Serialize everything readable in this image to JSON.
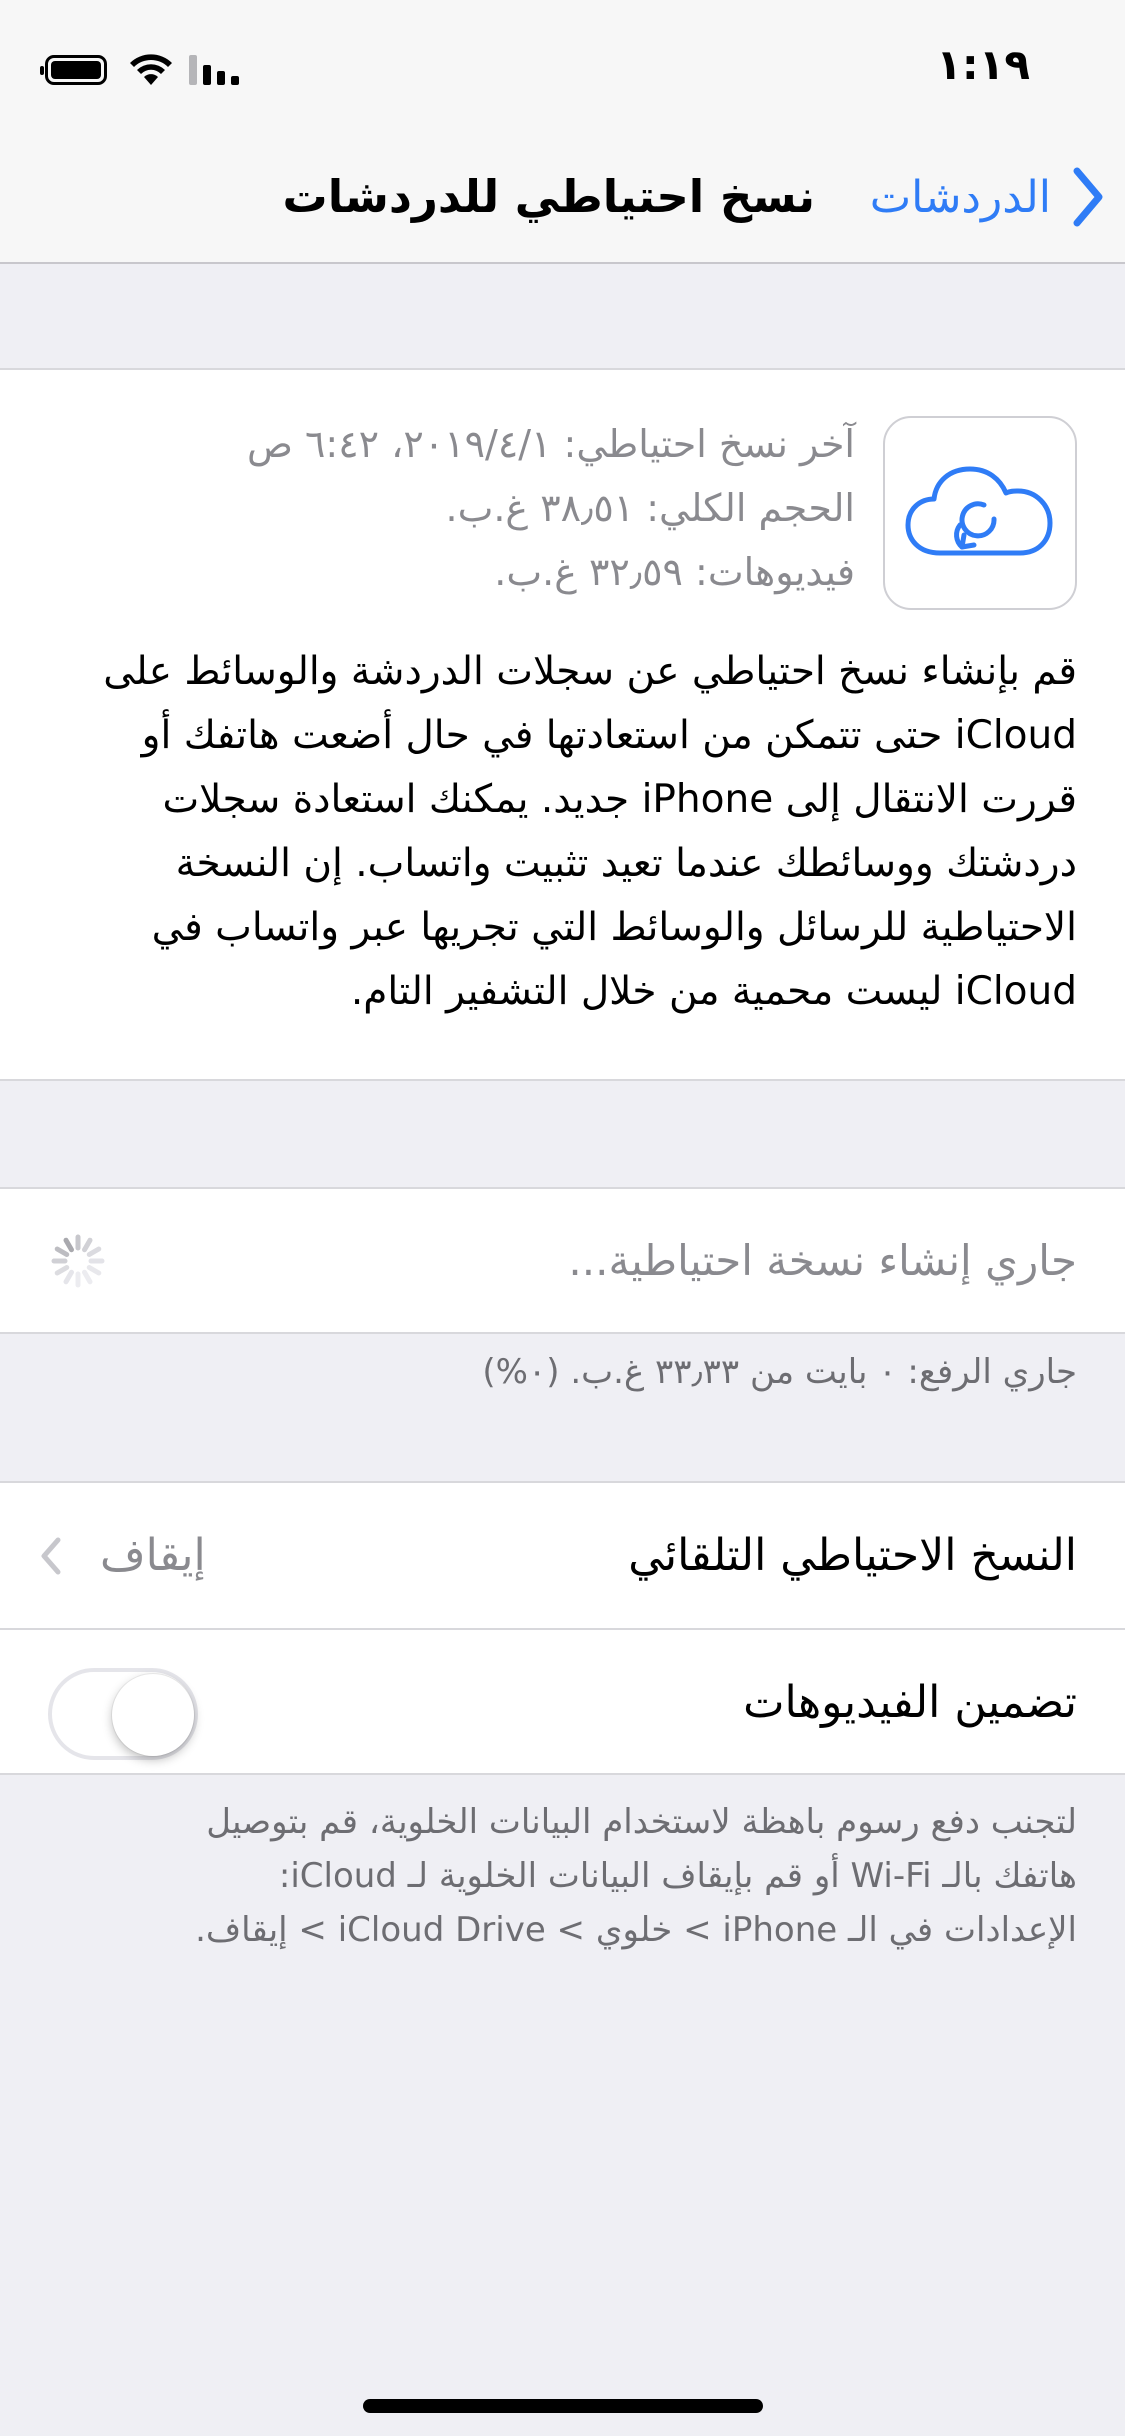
{
  "status_bar": {
    "time": "١:١٩"
  },
  "nav": {
    "back_label": "الدردشات",
    "title": "نسخ احتياطي للدردشات"
  },
  "backup_info": {
    "last_backup": "آخر نسخ احتياطي: ٢٠١٩/٤/١، ٦:٤٢ ص",
    "total_size": "الحجم الكلي: ٣٨٫٥١ غ.ب.",
    "videos_size": "فيديوهات: ٣٢٫٥٩ غ.ب.",
    "description": "قم بإنشاء نسخ احتياطي عن سجلات الدردشة والوسائط على iCloud حتى تتمكن من استعادتها في حال أضعت هاتفك أو قررت الانتقال إلى iPhone جديد. يمكنك استعادة سجلات دردشتك ووسائطك عندما تعيد تثبيت واتساب. إن النسخة الاحتياطية للرسائل والوسائط التي تجريها عبر واتساب في iCloud ليست محمية من خلال التشفير التام."
  },
  "progress": {
    "label": "جاري إنشاء نسخة احتياطية...",
    "upload_status": "جاري الرفع: ٠ بايت من ٣٣٫٣٣ غ.ب. (٠%)"
  },
  "settings": {
    "auto_backup_label": "النسخ الاحتياطي التلقائي",
    "auto_backup_value": "إيقاف",
    "include_videos_label": "تضمين الفيديوهات",
    "include_videos_on": false
  },
  "footer": {
    "line1": "لتجنب دفع رسوم باهظة لاستخدام البيانات الخلوية، قم بتوصيل",
    "line2": "هاتفك بالـ Wi-Fi أو قم بإيقاف البيانات الخلوية لـ iCloud:",
    "line3": "الإعدادات في الـ iPhone > خلوي > iCloud Drive > إيقاف."
  },
  "colors": {
    "accent": "#2f7cf6",
    "background": "#efeff4",
    "secondary_text": "#8a8a8f"
  },
  "icons": {
    "battery": "battery-icon",
    "wifi": "wifi-icon",
    "signal": "cellular-signal-icon",
    "back": "chevron-left-icon",
    "cloud": "icloud-backup-icon",
    "spinner": "activity-spinner-icon",
    "disclosure": "chevron-left-icon"
  }
}
